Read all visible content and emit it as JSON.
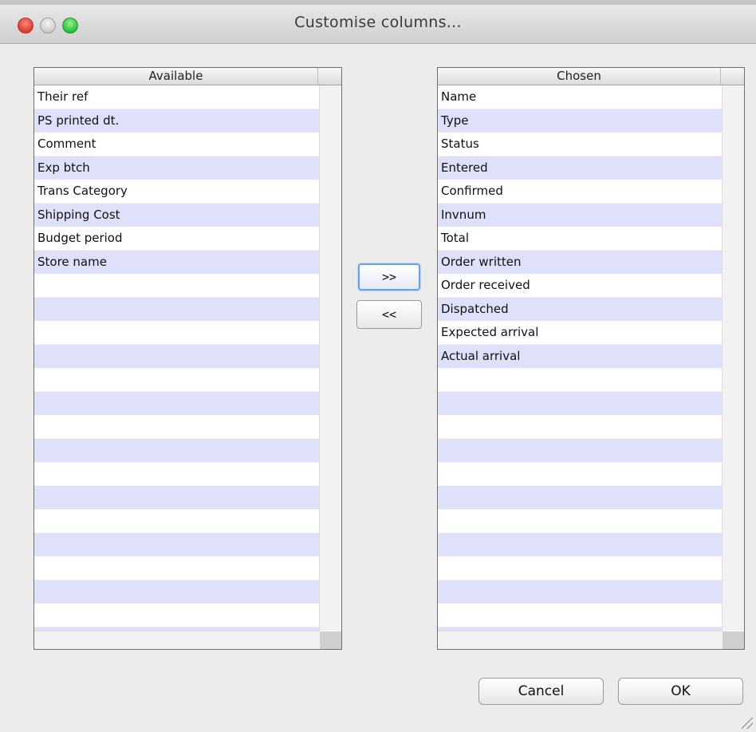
{
  "window": {
    "title": "Customise columns..."
  },
  "available": {
    "header": "Available",
    "items": [
      "Their ref",
      "PS printed dt.",
      "Comment",
      "Exp btch",
      "Trans Category",
      "Shipping Cost",
      "Budget period",
      "Store name"
    ]
  },
  "chosen": {
    "header": "Chosen",
    "items": [
      "Name",
      "Type",
      "Status",
      "Entered",
      "Confirmed",
      "Invnum",
      "Total",
      "Order written",
      "Order received",
      "Dispatched",
      "Expected arrival",
      "Actual arrival"
    ]
  },
  "buttons": {
    "move_right": ">>",
    "move_left": "<<",
    "cancel": "Cancel",
    "ok": "OK"
  },
  "colors": {
    "row_stripe": "#dfe1fb",
    "focus_ring": "#6aa0e8"
  }
}
